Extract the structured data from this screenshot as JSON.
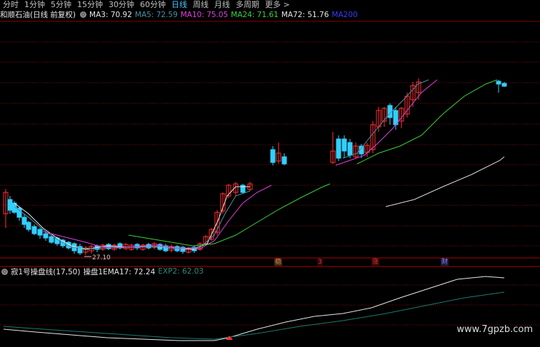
{
  "tabs": [
    "分时",
    "1分钟",
    "5分钟",
    "15分钟",
    "30分钟",
    "60分钟",
    "日线",
    "周线",
    "月线",
    "多周期",
    "更多 >"
  ],
  "active_tab": 6,
  "main_indicator": {
    "title": "和顺石油(日线 前复权)",
    "ma": [
      {
        "label": "MA3: 70.92",
        "color": "#e6e6e6"
      },
      {
        "label": "MA5: 72.59",
        "color": "#4a8fa8"
      },
      {
        "label": "MA10: 75.05",
        "color": "#e040e0"
      },
      {
        "label": "MA24: 71.61",
        "color": "#3ad03a"
      },
      {
        "label": "MA72: 51.76",
        "color": "#e6e6e6"
      },
      {
        "label": "MA200",
        "color": "#3a3aff"
      }
    ]
  },
  "low_label": "27.10",
  "events": [
    {
      "text": "稳",
      "color": "#e08030",
      "bg": "#3a2a1a"
    },
    {
      "text": "3",
      "color": "#e03030",
      "bg": "#2a0a0a"
    },
    {
      "text": "涨",
      "color": "#e03030",
      "bg": "#2a0a0a"
    },
    {
      "text": "财",
      "color": "#8080ff",
      "bg": "#1a1a3a"
    }
  ],
  "sub_indicator": {
    "title": "寂1号操盘线(17,50)",
    "items": [
      {
        "label": "操盘1EMA17: 72.24",
        "color": "#e6e6e6"
      },
      {
        "label": "EXP2: 62.03",
        "color": "#2a8a7a"
      }
    ]
  },
  "watermark": "www.7gpzb.com",
  "colors": {
    "up": "#ff3030",
    "down": "#30d0ff",
    "grid": "#8b0000",
    "bg": "#000000"
  }
}
